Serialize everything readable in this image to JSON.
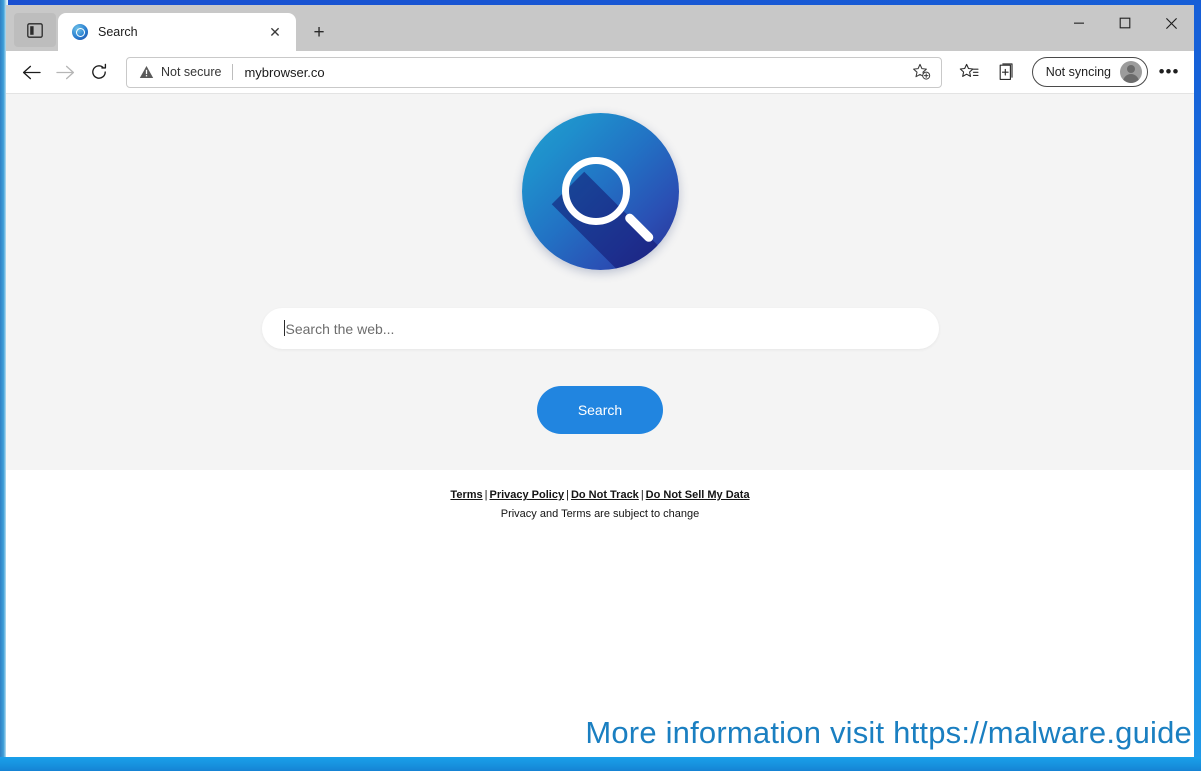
{
  "window": {
    "controls": {
      "minimize": "—",
      "maximize": "☐",
      "close": "✕"
    }
  },
  "tabstrip": {
    "tab_search_icon": "tab-search-icon",
    "tabs": [
      {
        "title": "Search",
        "favicon": "search-globe-favicon",
        "close": "✕"
      }
    ],
    "new_tab_label": "+"
  },
  "toolbar": {
    "back_label": "←",
    "forward_label": "→",
    "reload_label": "↻",
    "security": {
      "icon": "warning-triangle-icon",
      "label": "Not secure"
    },
    "url": "mybrowser.co",
    "add_favorite_icon": "add-favorite-star-icon",
    "favorites_icon": "favorites-list-icon",
    "collections_icon": "collections-icon",
    "profile": {
      "label": "Not syncing",
      "avatar": "user-avatar-icon"
    },
    "more_label": "•••"
  },
  "page": {
    "logo": {
      "name": "search-magnifier-logo",
      "gradient_from": "#21a0d0",
      "gradient_to": "#2b2f92"
    },
    "search": {
      "placeholder": "Search the web...",
      "value": "",
      "button_label": "Search",
      "button_color": "#2185e0"
    },
    "footer": {
      "links": [
        "Terms",
        "Privacy Policy",
        "Do Not Track",
        "Do Not Sell My Data"
      ],
      "separator": "|",
      "note": "Privacy and Terms are subject to change"
    }
  },
  "watermark": {
    "text": "More information visit https://malware.guide",
    "color": "#1a7fc1"
  }
}
